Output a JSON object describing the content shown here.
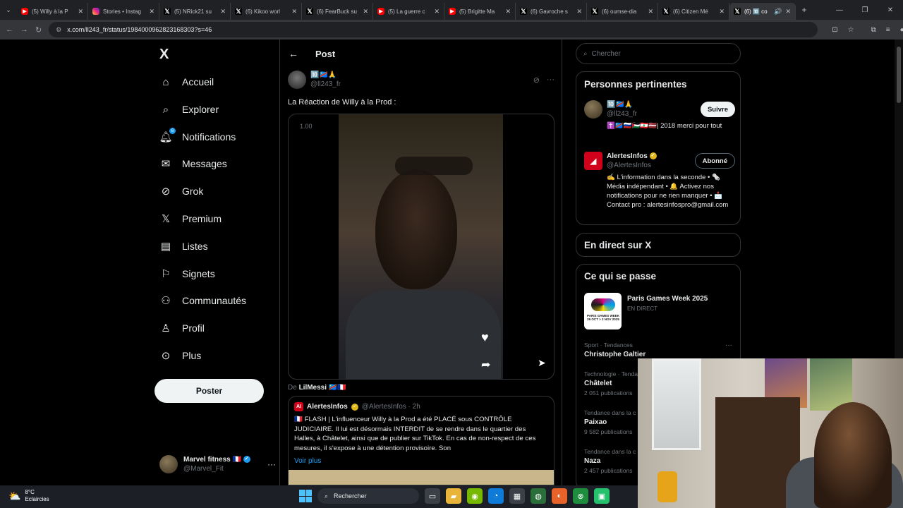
{
  "browser": {
    "tabs": [
      {
        "title": "(5) Willy à la P",
        "icon": "youtube-icon"
      },
      {
        "title": "Stories • Instag",
        "icon": "instagram-icon"
      },
      {
        "title": "(5) NRick21 su",
        "icon": "x-icon"
      },
      {
        "title": "(6) Kikoo worl",
        "icon": "x-icon"
      },
      {
        "title": "(6) FearBuck su",
        "icon": "x-icon"
      },
      {
        "title": "(5) La guerre c",
        "icon": "youtube-icon"
      },
      {
        "title": "(5) Brigitte Ma",
        "icon": "youtube-icon"
      },
      {
        "title": "(6) Gavroche s",
        "icon": "x-icon"
      },
      {
        "title": "(6) oumse-dia",
        "icon": "x-icon"
      },
      {
        "title": "(6) Citizen Mé",
        "icon": "x-icon"
      },
      {
        "title": "(6) 🔟 co",
        "icon": "x-icon",
        "active": true
      }
    ],
    "url": "x.com/ll243_fr/status/1984000962823168303?s=46"
  },
  "nav": {
    "logo": "X",
    "items": [
      {
        "label": "Accueil",
        "icon": "home-icon"
      },
      {
        "label": "Explorer",
        "icon": "search-icon"
      },
      {
        "label": "Notifications",
        "icon": "bell-icon",
        "badge": "6"
      },
      {
        "label": "Messages",
        "icon": "mail-icon"
      },
      {
        "label": "Grok",
        "icon": "grok-icon"
      },
      {
        "label": "Premium",
        "icon": "x-premium-icon"
      },
      {
        "label": "Listes",
        "icon": "list-icon"
      },
      {
        "label": "Signets",
        "icon": "bookmark-icon"
      },
      {
        "label": "Communautés",
        "icon": "communities-icon"
      },
      {
        "label": "Profil",
        "icon": "profile-icon"
      },
      {
        "label": "Plus",
        "icon": "more-circle-icon"
      }
    ],
    "post_button": "Poster",
    "account": {
      "name": "Marvel fitness 🇫🇷",
      "handle": "@Marvel_Fit"
    }
  },
  "main": {
    "header_title": "Post",
    "author": {
      "name": "🔟🇨🇩🙏",
      "handle": "@ll243_fr"
    },
    "text": "La Réaction de Willy à la Prod :",
    "video": {
      "speed": "1.00"
    },
    "from": {
      "prefix": "De ",
      "name": "LilMessi",
      "flags": "🇨🇩🇫🇷"
    },
    "quote": {
      "name": "AlertesInfos",
      "handle": "@AlertesInfos · 2h",
      "text": "🇫🇷 FLASH | L'influenceur Willy à la Prod a été PLACÉ sous CONTRÔLE JUDICIAIRE. Il lui est désormais INTERDIT de se rendre dans le quartier des Halles, à Châtelet, ainsi que de publier sur TikTok. En cas de non-respect de ces mesures, il s'expose à une détention provisoire. Son",
      "more": "Voir plus"
    }
  },
  "right": {
    "search_placeholder": "Chercher",
    "relevant_title": "Personnes pertinentes",
    "people": [
      {
        "name": "🔟🇨🇩🙏",
        "handle": "@ll243_fr",
        "bio": "✝️🇨🇩🇷🇺🇵🇸🇱🇧🇱🇻| 2018 merci pour tout",
        "button": "Suivre"
      },
      {
        "name": "AlertesInfos",
        "handle": "@AlertesInfos",
        "bio": "✍️ L'information dans la seconde • 🗞️ Média indépendant • 🔔 Activez nos notifications pour ne rien manquer • 📩 Contact pro : alertesinfospro@gmail.com",
        "button": "Abonné"
      }
    ],
    "live_title": "En direct sur X",
    "happening_title": "Ce qui se passe",
    "event": {
      "title": "Paris Games Week 2025",
      "status": "EN DIRECT",
      "thumb_label": "PARIS GAMES WEEK 29 OCT > 2 NOV 2025"
    },
    "trends": [
      {
        "category": "Sport · Tendances",
        "name": "Christophe Galtier",
        "count": ""
      },
      {
        "category": "Technologie · Tendances",
        "name": "Châtelet",
        "count": "2 051 publications"
      },
      {
        "category": "Tendance dans la c",
        "name": "Paixao",
        "count": "9 582 publications"
      },
      {
        "category": "Tendance dans la c",
        "name": "Naza",
        "count": "2 457 publications"
      }
    ]
  },
  "taskbar": {
    "weather_temp": "8°C",
    "weather_desc": "Eclaircies",
    "search_label": "Rechercher"
  }
}
